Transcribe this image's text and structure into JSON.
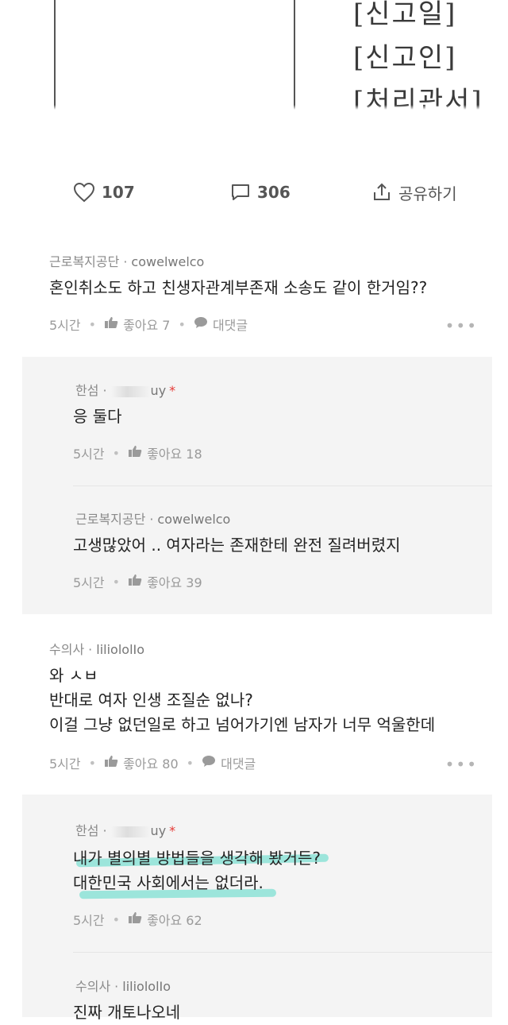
{
  "document_crop": {
    "lines": [
      "[신고일]",
      "[신고인]",
      "[처리관서]"
    ]
  },
  "actions": {
    "likes": "107",
    "comments": "306",
    "share_label": "공유하기"
  },
  "comments": [
    {
      "author": "근로복지공단",
      "username": "cowelwelco",
      "text": [
        "혼인취소도 하고 친생자관계부존재 소송도 같이 한거임??"
      ],
      "time": "5시간",
      "likes": "좋아요 7",
      "reply_label": "대댓글"
    },
    {
      "author": "한섬",
      "username": "uy",
      "text": [
        "응 둘다"
      ],
      "time": "5시간",
      "likes": "좋아요 18"
    },
    {
      "author": "근로복지공단",
      "username": "cowelwelco",
      "text": [
        "고생많았어 .. 여자라는 존재한테 완전 질려버렸지"
      ],
      "time": "5시간",
      "likes": "좋아요 39"
    },
    {
      "author": "수의사",
      "username": "liliololIo",
      "text": [
        "와 ㅅㅂ",
        "반대로 여자 인생 조질순 없나?",
        "이걸 그냥 없던일로 하고 넘어가기엔 남자가 너무 억울한데"
      ],
      "time": "5시간",
      "likes": "좋아요 80",
      "reply_label": "대댓글"
    },
    {
      "author": "한섬",
      "username": "uy",
      "text": [
        "내가 별의별 방법들을 생각해 봤거든?",
        "대한민국 사회에서는 없더라."
      ],
      "time": "5시간",
      "likes": "좋아요 62"
    },
    {
      "author": "수의사",
      "username": "liliololIo",
      "text": [
        "진짜 개토나오네"
      ]
    }
  ],
  "colors": {
    "highlight": "#7fe0d3",
    "star": "#e53935",
    "reply_bg": "#f4f4f4"
  }
}
